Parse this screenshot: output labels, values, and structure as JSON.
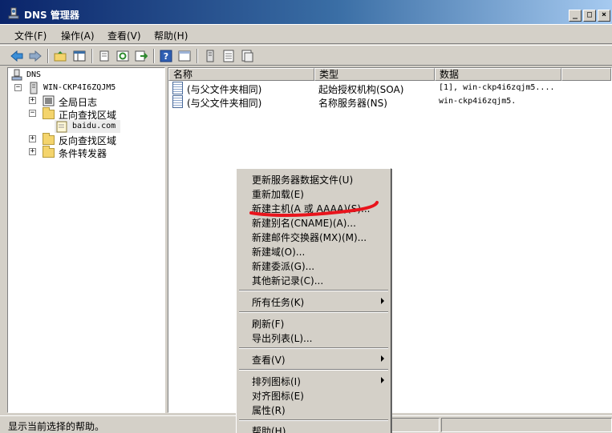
{
  "window": {
    "title": "DNS 管理器",
    "controls": [
      "_",
      "□",
      "×"
    ]
  },
  "menubar": [
    "文件(F)",
    "操作(A)",
    "查看(V)",
    "帮助(H)"
  ],
  "toolbar": {
    "icons": [
      "back-arrow-icon",
      "forward-arrow-icon",
      "up-folder-icon",
      "show-hide-tree-icon",
      "properties-icon",
      "refresh-icon",
      "export-list-icon",
      "help-icon",
      "console-icon",
      "server-icon",
      "list-icon",
      "record-icon"
    ]
  },
  "tree": {
    "root": "DNS",
    "server": "WIN-CKP4I6ZQJM5",
    "global_logs": "全局日志",
    "forward_zones": "正向查找区域",
    "zone": "baidu.com",
    "reverse_zones": "反向查找区域",
    "conditional_forwarders": "条件转发器"
  },
  "list": {
    "headers": [
      "名称",
      "类型",
      "数据"
    ],
    "rows": [
      {
        "name": "(与父文件夹相同)",
        "type": "起始授权机构(SOA)",
        "data": "[1], win-ckp4i6zqjm5...."
      },
      {
        "name": "(与父文件夹相同)",
        "type": "名称服务器(NS)",
        "data": "win-ckp4i6zqjm5."
      }
    ]
  },
  "context_menu": {
    "group1": [
      "更新服务器数据文件(U)",
      "重新加载(E)",
      "新建主机(A 或 AAAA)(S)...",
      "新建别名(CNAME)(A)...",
      "新建邮件交换器(MX)(M)...",
      "新建域(O)...",
      "新建委派(G)...",
      "其他新记录(C)..."
    ],
    "all_tasks": "所有任务(K)",
    "group3": [
      "刷新(F)",
      "导出列表(L)..."
    ],
    "view": "查看(V)",
    "arrange": "排列图标(I)",
    "group5": [
      "对齐图标(E)",
      "属性(R)"
    ],
    "help": "帮助(H)",
    "highlight_color": "#e8141c"
  },
  "statusbar": {
    "text": "显示当前选择的帮助。"
  }
}
